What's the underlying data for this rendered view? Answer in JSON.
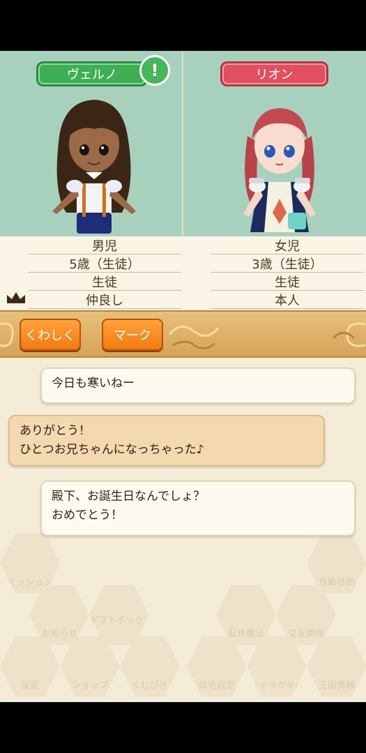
{
  "characters": {
    "left": {
      "name": "ヴェルノ",
      "gender": "男児",
      "age": "5歳（生徒）",
      "role": "生徒",
      "relation": "仲良し",
      "alert": "!"
    },
    "right": {
      "name": "リオン",
      "gender": "女児",
      "age": "3歳（生徒）",
      "role": "生徒",
      "relation": "本人"
    }
  },
  "buttons": {
    "detail": "くわしく",
    "mark": "マーク"
  },
  "messages": [
    {
      "text": "今日も寒いねー",
      "style": "white"
    },
    {
      "text": "ありがとう！",
      "text2": "ひとつお兄ちゃんになっちゃった♪",
      "style": "tan"
    },
    {
      "text": "殿下、お誕生日なんでしょ？",
      "text2": "おめでとう！",
      "style": "white"
    }
  ],
  "background_menu": {
    "items": [
      "ミッション",
      "自動移動",
      "お知らせ",
      "ギフトボックス",
      "転移魔法",
      "交友関係",
      "設定",
      "ショップ",
      "くじびき",
      "武術設定",
      "キャラクター",
      "王国情報"
    ]
  },
  "colors": {
    "portrait_bg": "#a7d1bd",
    "left_tag": "#3fae57",
    "right_tag": "#e05060",
    "button_orange": "#f07a12",
    "bar_gold": "#d6a35a"
  }
}
